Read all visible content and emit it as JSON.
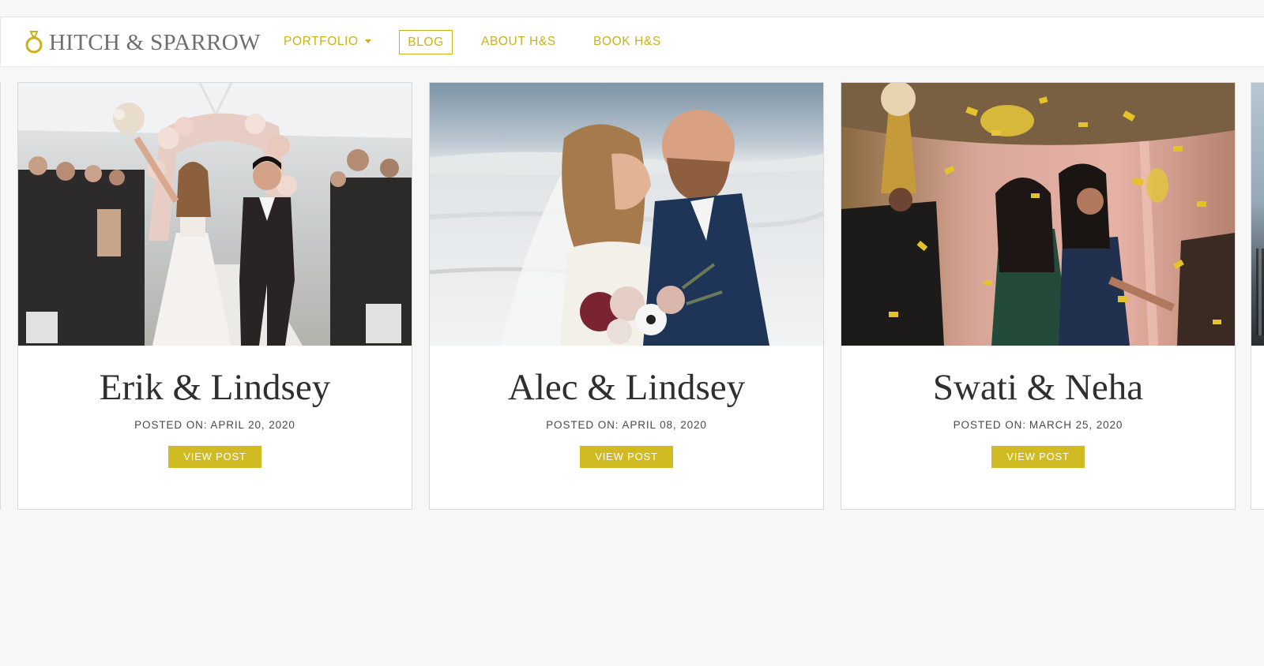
{
  "brand": {
    "name": "HITCH & SPARROW",
    "icon": "ring-icon",
    "accent_color": "#c9b21a"
  },
  "nav": {
    "items": [
      {
        "label": "PORTFOLIO",
        "has_dropdown": true
      },
      {
        "label": "BLOG",
        "active": true
      },
      {
        "label": "ABOUT H&S"
      },
      {
        "label": "BOOK H&S"
      }
    ]
  },
  "posts": [
    {
      "title": "Erik & Lindsey",
      "date_label": "POSTED ON:",
      "date": "APRIL 20, 2020",
      "button": "VIEW POST"
    },
    {
      "title": "Alec & Lindsey",
      "date_label": "POSTED ON:",
      "date": "APRIL 08, 2020",
      "button": "VIEW POST"
    },
    {
      "title": "Swati & Neha",
      "date_label": "POSTED ON:",
      "date": "MARCH 25, 2020",
      "button": "VIEW POST"
    }
  ],
  "colors": {
    "button_bg": "#d1bb22",
    "title_text": "#2f2f2f",
    "page_bg": "#f7f7f7"
  }
}
